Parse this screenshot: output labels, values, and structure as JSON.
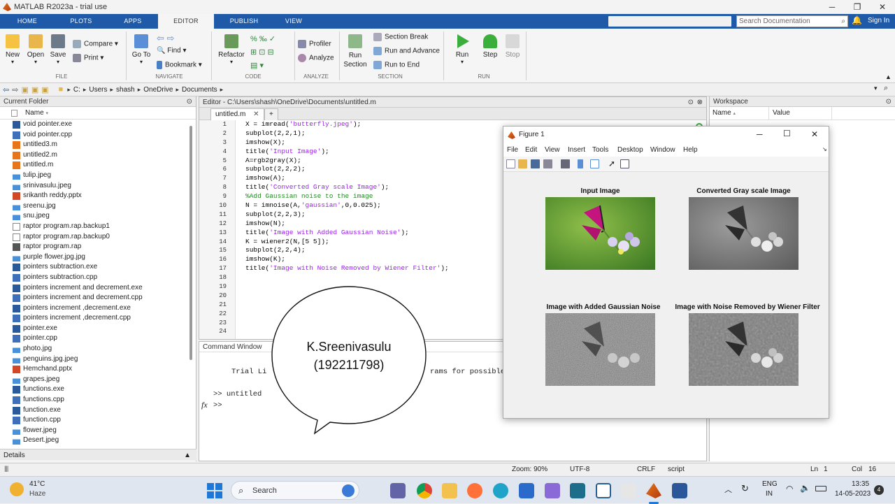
{
  "window": {
    "title": "MATLAB R2023a - trial use"
  },
  "ribbon_tabs": [
    "HOME",
    "PLOTS",
    "APPS",
    "EDITOR",
    "PUBLISH",
    "VIEW"
  ],
  "active_tab": "EDITOR",
  "search_documentation": {
    "placeholder": "Search Documentation"
  },
  "sign_in": "Sign In",
  "ribbon": {
    "file": {
      "new": "New",
      "open": "Open",
      "save": "Save",
      "compare": "Compare",
      "print": "Print",
      "section": "FILE"
    },
    "navigate": {
      "goto": "Go To",
      "find": "Find",
      "bookmark": "Bookmark",
      "section": "NAVIGATE"
    },
    "code": {
      "refactor": "Refactor",
      "section": "CODE"
    },
    "analyze": {
      "profiler": "Profiler",
      "analyze": "Analyze",
      "section": "ANALYZE"
    },
    "section_grp": {
      "run_section": "Run Section",
      "section_break": "Section Break",
      "run_and_advance": "Run and Advance",
      "run_to_end": "Run to End",
      "section": "SECTION"
    },
    "run": {
      "run": "Run",
      "step": "Step",
      "stop": "Stop",
      "section": "RUN"
    }
  },
  "address": {
    "crumbs": [
      "C:",
      "Users",
      "shash",
      "OneDrive",
      "Documents"
    ]
  },
  "current_folder": {
    "title": "Current Folder",
    "name_header": "Name",
    "files": [
      {
        "name": "void pointer.exe",
        "type": "exe"
      },
      {
        "name": "void pointer.cpp",
        "type": "cpp"
      },
      {
        "name": "untitled3.m",
        "type": "m"
      },
      {
        "name": "untitled2.m",
        "type": "m"
      },
      {
        "name": "untitled.m",
        "type": "m"
      },
      {
        "name": "tulip.jpeg",
        "type": "img"
      },
      {
        "name": "srinivasulu.jpeg",
        "type": "img"
      },
      {
        "name": "srikanth reddy.pptx",
        "type": "ppt"
      },
      {
        "name": "sreenu.jpg",
        "type": "img"
      },
      {
        "name": "snu.jpeg",
        "type": "img"
      },
      {
        "name": "raptor program.rap.backup1",
        "type": "doc"
      },
      {
        "name": "raptor program.rap.backup0",
        "type": "doc"
      },
      {
        "name": "raptor program.rap",
        "type": "rap"
      },
      {
        "name": "purple flower.jpg.jpg",
        "type": "img"
      },
      {
        "name": "pointers subtraction.exe",
        "type": "exe"
      },
      {
        "name": "pointers subtraction.cpp",
        "type": "cpp"
      },
      {
        "name": "pointers increment and decrement.exe",
        "type": "exe"
      },
      {
        "name": "pointers increment and decrement.cpp",
        "type": "cpp"
      },
      {
        "name": "pointers increment ,decrement.exe",
        "type": "exe"
      },
      {
        "name": "pointers increment ,decrement.cpp",
        "type": "cpp"
      },
      {
        "name": "pointer.exe",
        "type": "exe"
      },
      {
        "name": "pointer.cpp",
        "type": "cpp"
      },
      {
        "name": "photo.jpg",
        "type": "img"
      },
      {
        "name": "penguins.jpg.jpeg",
        "type": "img"
      },
      {
        "name": "Hemchand.pptx",
        "type": "ppt"
      },
      {
        "name": "grapes.jpeg",
        "type": "img"
      },
      {
        "name": "functions.exe",
        "type": "exe"
      },
      {
        "name": "functions.cpp",
        "type": "cpp"
      },
      {
        "name": "function.exe",
        "type": "exe"
      },
      {
        "name": "function.cpp",
        "type": "cpp"
      },
      {
        "name": "flower.jpeg",
        "type": "img"
      },
      {
        "name": "Desert.jpeg",
        "type": "img"
      }
    ],
    "details": "Details"
  },
  "editor": {
    "title": "Editor - C:\\Users\\shash\\OneDrive\\Documents\\untitled.m",
    "tab": "untitled.m",
    "lines": [
      [
        [
          "X = imread(",
          "k"
        ],
        [
          "'butterfly.jpeg'",
          "s"
        ],
        [
          ");",
          "k"
        ]
      ],
      [
        [
          "subplot(2,2,1);",
          "k"
        ]
      ],
      [
        [
          "imshow(X);",
          "k"
        ]
      ],
      [
        [
          "title(",
          "k"
        ],
        [
          "'Input Image'",
          "s"
        ],
        [
          ");",
          "k"
        ]
      ],
      [
        [
          "A=rgb2gray(X);",
          "k"
        ]
      ],
      [
        [
          "subplot(2,2,2);",
          "k"
        ]
      ],
      [
        [
          "imshow(A);",
          "k"
        ]
      ],
      [
        [
          "title(",
          "k"
        ],
        [
          "'Converted Gray scale Image'",
          "s"
        ],
        [
          ");",
          "k"
        ]
      ],
      [
        [
          "%Add Gaussian noise to the image",
          "c"
        ]
      ],
      [
        [
          "N = imnoise(A,",
          "k"
        ],
        [
          "'gaussian'",
          "s"
        ],
        [
          ",0,0.025);",
          "k"
        ]
      ],
      [
        [
          "subplot(2,2,3);",
          "k"
        ]
      ],
      [
        [
          "imshow(N);",
          "k"
        ]
      ],
      [
        [
          "title(",
          "k"
        ],
        [
          "'Image with Added Gaussian Noise'",
          "s"
        ],
        [
          ");",
          "k"
        ]
      ],
      [
        [
          "K = wiener2(N,[5 5]);",
          "k"
        ]
      ],
      [
        [
          "subplot(2,2,4);",
          "k"
        ]
      ],
      [
        [
          "imshow(K);",
          "k"
        ]
      ],
      [
        [
          "title(",
          "k"
        ],
        [
          "'Image with Noise Removed by Wiener Filter'",
          "s"
        ],
        [
          ");",
          "k"
        ]
      ],
      [],
      [],
      [],
      [],
      [],
      [],
      []
    ]
  },
  "command_window": {
    "title": "Command Window",
    "trial_left": "Trial Li",
    "trial_right": "rams for possible",
    "prompt_line": ">> untitled",
    "prompt": ">>",
    "fx": "fx"
  },
  "workspace": {
    "title": "Workspace",
    "col_name": "Name",
    "col_value": "Value"
  },
  "status": {
    "zoom": "Zoom: 90%",
    "encoding": "UTF-8",
    "eol": "CRLF",
    "type": "script",
    "ln_label": "Ln",
    "ln": "1",
    "col_label": "Col",
    "col": "16"
  },
  "figure": {
    "title": "Figure 1",
    "menu": [
      "File",
      "Edit",
      "View",
      "Insert",
      "Tools",
      "Desktop",
      "Window",
      "Help"
    ],
    "subplots": [
      "Input Image",
      "Converted Gray scale Image",
      "Image with Added Gaussian Noise",
      "Image with Noise Removed by Wiener Filter"
    ]
  },
  "bubble": {
    "line1": "K.Sreenivasulu",
    "line2": "(192211798)"
  },
  "taskbar": {
    "weather_temp": "41°C",
    "weather_desc": "Haze",
    "search": "Search",
    "lang1": "ENG",
    "lang2": "IN",
    "time": "13:35",
    "date": "14-05-2023",
    "notif_count": "4"
  },
  "colors": {
    "tab_blue": "#1e5aa8",
    "string": "#a020f0",
    "comment": "#228b22"
  }
}
